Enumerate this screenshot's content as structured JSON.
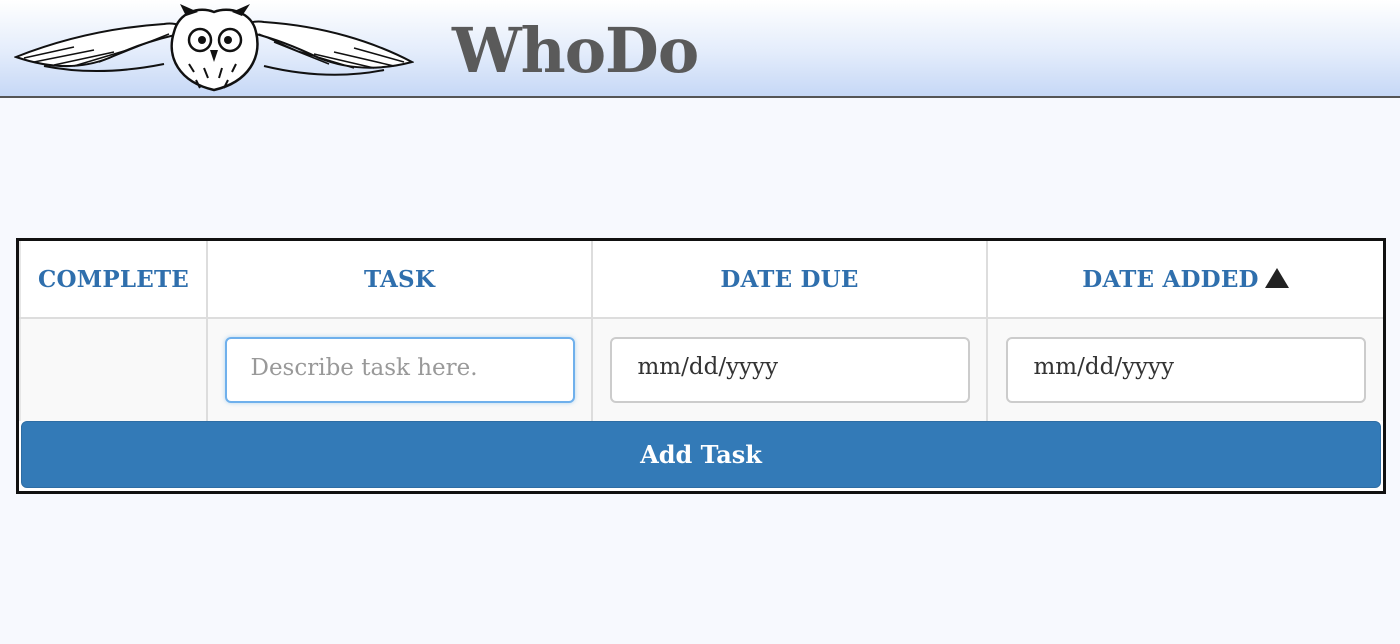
{
  "app": {
    "title": "WhoDo",
    "logo_icon": "owl-logo-icon"
  },
  "table": {
    "columns": [
      {
        "label": "COMPLETE"
      },
      {
        "label": "TASK"
      },
      {
        "label": "DATE DUE"
      },
      {
        "label": "DATE ADDED",
        "sort": "ascending",
        "sort_icon": "sort-up-triangle-icon"
      }
    ],
    "new_task": {
      "task_placeholder": "Describe task here.",
      "task_value": "",
      "date_due_placeholder": "mm/dd/yyyy",
      "date_added_placeholder": "mm/dd/yyyy"
    },
    "add_button_label": "Add Task"
  },
  "colors": {
    "header_text": "#5a5a5a",
    "column_header": "#2f6fad",
    "button": "#337ab7",
    "focus_border": "#6fb0ec"
  }
}
